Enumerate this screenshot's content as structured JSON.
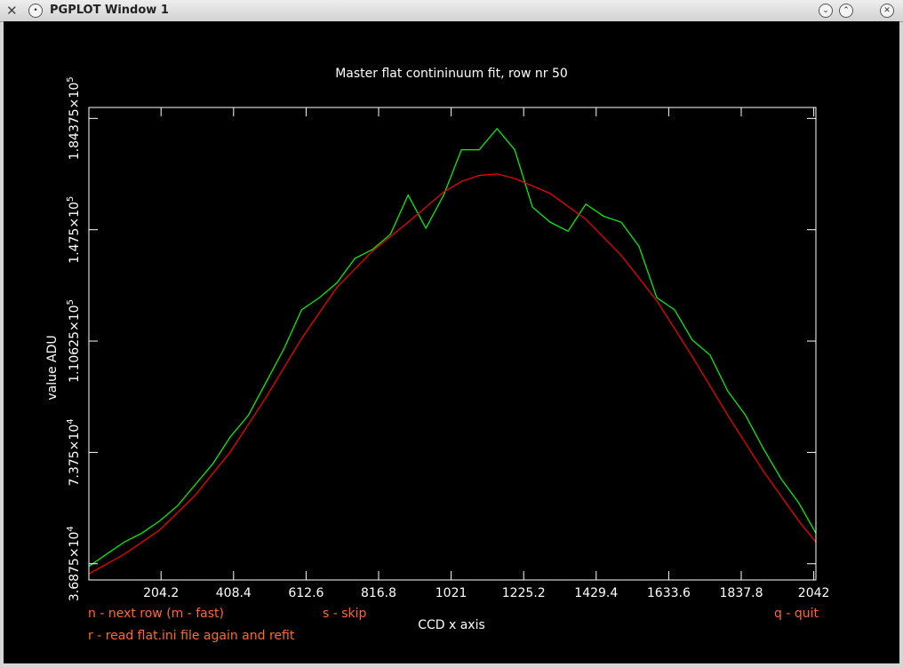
{
  "window": {
    "title": "PGPLOT Window 1"
  },
  "colors": {
    "background": "#000000",
    "axes": "#ffffff",
    "data": "#00ff00",
    "fit": "#ff0000",
    "help": "#ff6a2a"
  },
  "icons": {
    "app": "x-icon",
    "menu": "menu-icon",
    "minimize": "chevron-down-icon",
    "maximize": "chevron-up-icon",
    "close": "close-icon"
  },
  "help": {
    "next_row": "n - next row (m - fast)",
    "skip": "s - skip",
    "quit": "q - quit",
    "reread": "r - read flat.ini file again and refit"
  },
  "chart_data": {
    "type": "line",
    "title": "Master flat contininuum fit, row nr 50",
    "xlabel": "CCD x axis",
    "ylabel": "value ADU",
    "xlim": [
      1,
      2048
    ],
    "ylim": [
      31500,
      188000
    ],
    "x_ticks": [
      "204.2",
      "408.4",
      "612.6",
      "816.8",
      "1021",
      "1225.2",
      "1429.4",
      "1633.6",
      "1837.8",
      "2042"
    ],
    "y_ticks": [
      {
        "mantissa": "3.6875",
        "exp": "4"
      },
      {
        "mantissa": "7.375",
        "exp": "4"
      },
      {
        "mantissa": "1.10625",
        "exp": "5"
      },
      {
        "mantissa": "1.475",
        "exp": "5"
      },
      {
        "mantissa": "1.84375",
        "exp": "5"
      }
    ],
    "series": [
      {
        "x": [
          1,
          50,
          100,
          150,
          200,
          250,
          300,
          350,
          400,
          450,
          500,
          550,
          600,
          650,
          700,
          750,
          800,
          850,
          900,
          950,
          1000,
          1050,
          1100,
          1150,
          1200,
          1250,
          1300,
          1350,
          1400,
          1450,
          1500,
          1550,
          1600,
          1650,
          1700,
          1750,
          1800,
          1850,
          1900,
          1950,
          2000,
          2048
        ],
        "y": [
          36000,
          40000,
          44000,
          47000,
          51000,
          56000,
          63000,
          70000,
          79000,
          86000,
          97000,
          108000,
          121000,
          125000,
          130000,
          138000,
          141000,
          146000,
          159000,
          148000,
          159000,
          174000,
          174000,
          181000,
          174000,
          155000,
          150000,
          147000,
          156000,
          152000,
          150000,
          142000,
          125000,
          121000,
          111000,
          106000,
          94000,
          86000,
          75000,
          65000,
          57000,
          47000
        ],
        "color": "#00ff00"
      },
      {
        "x": [
          1,
          100,
          200,
          300,
          400,
          500,
          600,
          700,
          800,
          900,
          1000,
          1050,
          1100,
          1150,
          1200,
          1300,
          1400,
          1500,
          1600,
          1700,
          1800,
          1900,
          2000,
          2048
        ],
        "y": [
          33500,
          40000,
          48000,
          59500,
          74000,
          92000,
          111500,
          128500,
          140500,
          150000,
          160000,
          163500,
          165500,
          166000,
          164500,
          159500,
          151000,
          139000,
          124000,
          105500,
          86000,
          67500,
          51000,
          44000
        ],
        "color": "#ff0000"
      }
    ]
  }
}
